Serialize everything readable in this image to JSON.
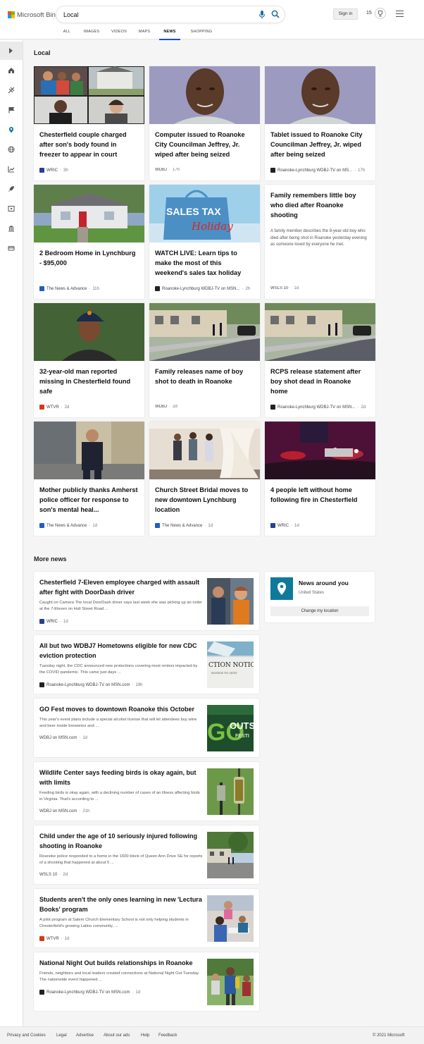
{
  "brand": {
    "name": "Microsoft Bing",
    "colors": [
      "#f25022",
      "#7fba00",
      "#00a4ef",
      "#ffb900"
    ]
  },
  "search": {
    "query": "Local"
  },
  "header": {
    "sign_in": "Sign in",
    "rewards_count": "15"
  },
  "tabs": [
    "ALL",
    "IMAGES",
    "VIDEOS",
    "MAPS",
    "NEWS",
    "SHOPPING"
  ],
  "active_tab": "NEWS",
  "sidebar": {
    "icons": [
      "home-icon",
      "sports-icon",
      "us-news-icon",
      "local-icon",
      "world-icon",
      "business-icon",
      "sci-tech-icon",
      "entertainment-icon",
      "politics-icon",
      "money-icon"
    ],
    "active": "local-icon",
    "accent": "#0e7a9b"
  },
  "local": {
    "heading": "Local",
    "cards": [
      {
        "title": "Chesterfield couple charged after son's body found in freezer to appear in court",
        "source": "WRIC",
        "ago": "3h",
        "image": "mugshot-collage",
        "favicon_color": "#2a3f8f"
      },
      {
        "title": "Computer issued to Roanoke City Councilman Jeffrey, Jr. wiped after being seized",
        "source": "WDBJ",
        "ago": "17h",
        "image": "man-portrait"
      },
      {
        "title": "Tablet issued to Roanoke City Councilman Jeffrey, Jr. wiped after being seized",
        "source": "Roanoke-Lynchburg WDBJ-TV on MS...",
        "ago": "17h",
        "image": "man-portrait",
        "favicon_color": "#222222"
      },
      {
        "title": "2 Bedroom Home in Lynchburg - $95,000",
        "source": "The News & Advance",
        "ago": "11h",
        "image": "house-photo",
        "favicon_color": "#1f5fbf"
      },
      {
        "title": "WATCH LIVE: Learn tips to make the most of this weekend's sales tax holiday",
        "source": "Roanoke-Lynchburg WDBJ-TV on MSN...",
        "ago": "2h",
        "image": "sales-tax-bag",
        "bag_text_a": "SALES TAX",
        "bag_text_b": "Holiday",
        "favicon_color": "#222222"
      },
      {
        "title": "Family remembers little boy who died after Roanoke shooting",
        "desc": "A family member describes the 8-year-old boy who died after being shot in Roanoke yesterday evening as someone loved by everyone he met.",
        "source": "WSLS 10",
        "ago": "1d",
        "image": "none"
      },
      {
        "title": "32-year-old man reported missing in Chesterfield found safe",
        "source": "WTVR",
        "ago": "2d",
        "image": "man-cap-photo",
        "favicon_color": "#d33a1e"
      },
      {
        "title": "Family releases name of boy shot to death in Roanoke",
        "source": "WDBJ",
        "ago": "2d",
        "image": "street-scene"
      },
      {
        "title": "RCPS release statement after boy shot dead in Roanoke home",
        "source": "Roanoke-Lynchburg WDBJ-TV on MSN...",
        "ago": "2d",
        "image": "street-scene",
        "favicon_color": "#222222"
      },
      {
        "title": "Mother publicly thanks Amherst police officer for response to son's mental heal...",
        "source": "The News & Advance",
        "ago": "1d",
        "image": "police-officer",
        "favicon_color": "#1f5fbf"
      },
      {
        "title": "Church Street Bridal moves to new downtown Lynchburg location",
        "source": "The News & Advance",
        "ago": "1d",
        "image": "bridal-shop",
        "favicon_color": "#1f5fbf"
      },
      {
        "title": "4 people left without home following fire in Chesterfield",
        "source": "WRIC",
        "ago": "1d",
        "image": "night-fire-scene",
        "favicon_color": "#2a3f8f"
      }
    ]
  },
  "more": {
    "heading": "More news",
    "items": [
      {
        "title": "Chesterfield 7-Eleven employee charged with assault after fight with DoorDash driver",
        "snippet": "Caught on Camera The local DoorDash driver says last week she was picking up an order at the 7-Eleven on Hull Street Road ...",
        "source": "WRIC",
        "ago": "1d",
        "image": "store-camera",
        "favicon_color": "#2a3f8f"
      },
      {
        "title": "All but two WDBJ7 Hometowns eligible for new CDC eviction protection",
        "snippet": "Tuesday night, the CDC announced new protections covering most renters impacted by the COVID pandemic. This came just days ...",
        "source": "Roanoke-Lynchburg WDBJ-TV on MSN.com",
        "ago": "19h",
        "image": "eviction-notice",
        "notice_text": "CTION NOTIC",
        "notice_sub": "NOTICE TO QUIT",
        "favicon_color": "#222222"
      },
      {
        "title": "GO Fest moves to downtown Roanoke this October",
        "snippet": "This year's event plans include a special alcohol license that will let attendees buy wine and beer inside breweries and ...",
        "source": "WDBJ on MSN.com",
        "ago": "1d",
        "image": "go-fest-logo",
        "logo_text": "GO",
        "logo_text2": "OUTS",
        "logo_text3": "FESTI"
      },
      {
        "title": "Wildlife Center says feeding birds is okay again, but with limits",
        "snippet": "Feeding birds is okay again, with a declining number of cases of an illness affecting birds in Virginia. That's according to ...",
        "source": "WDBJ on MSN.com",
        "ago": "21h",
        "image": "bird-feeder"
      },
      {
        "title": "Child under the age of 10 seriously injured following shooting in Roanoke",
        "snippet": "Roanoke police responded to a home in the 1600 block of Queen Ann Drive SE for reports of a shooting that happened at about 5 ...",
        "source": "WSLS 10",
        "ago": "2d",
        "image": "neighborhood-scene"
      },
      {
        "title": "Students aren't the only ones learning in new 'Lectura Books' program",
        "snippet": "A pilot program at Salem Church Elementary School is not only helping students in Chesterfield's growing Latino community, ...",
        "source": "WTVR",
        "ago": "1d",
        "image": "classroom",
        "favicon_color": "#d33a1e"
      },
      {
        "title": "National Night Out builds relationships in Roanoke",
        "snippet": "Friends, neighbors and local leaders created connections at National Night Out Tuesday. The nationwide event happened ...",
        "source": "Roanoke-Lynchburg WDBJ-TV on MSN.com",
        "ago": "1d",
        "image": "outdoor-crowd",
        "favicon_color": "#222222"
      }
    ]
  },
  "news_around": {
    "title": "News around you",
    "location": "United States",
    "button": "Change my location"
  },
  "footer": {
    "links": [
      "Privacy and Cookies",
      "Legal",
      "Advertise",
      "About our ads",
      "Help",
      "Feedback"
    ],
    "copyright": "© 2021 Microsoft"
  }
}
